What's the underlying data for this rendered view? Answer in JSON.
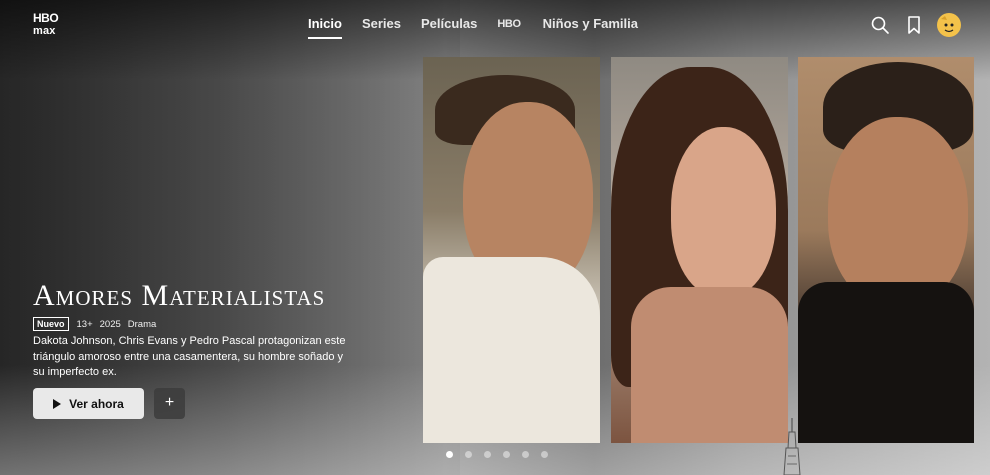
{
  "brand": {
    "logo_line1": "HBO",
    "logo_line2": "max"
  },
  "nav": {
    "items": [
      {
        "label": "Inicio",
        "active": true
      },
      {
        "label": "Series",
        "active": false
      },
      {
        "label": "Películas",
        "active": false
      },
      {
        "label": "HBO",
        "active": false
      },
      {
        "label": "Niños y Familia",
        "active": false
      }
    ]
  },
  "header_icons": [
    "search-icon",
    "bookmark-icon",
    "avatar"
  ],
  "hero": {
    "title": "Amores Materialistas",
    "badge": "Nuevo",
    "rating": "13+",
    "year": "2025",
    "genre": "Drama",
    "description": "Dakota Johnson, Chris Evans y Pedro Pascal protagonizan este triángulo amoroso entre una casamentera, su hombre soñado y su imperfecto ex.",
    "play_label": "Ver ahora",
    "add_label": "+"
  },
  "carousel": {
    "total": 6,
    "active_index": 0
  },
  "colors": {
    "accent": "#ffffff",
    "button_bg": "#e9e9e9",
    "avatar": "#f4c24a"
  }
}
